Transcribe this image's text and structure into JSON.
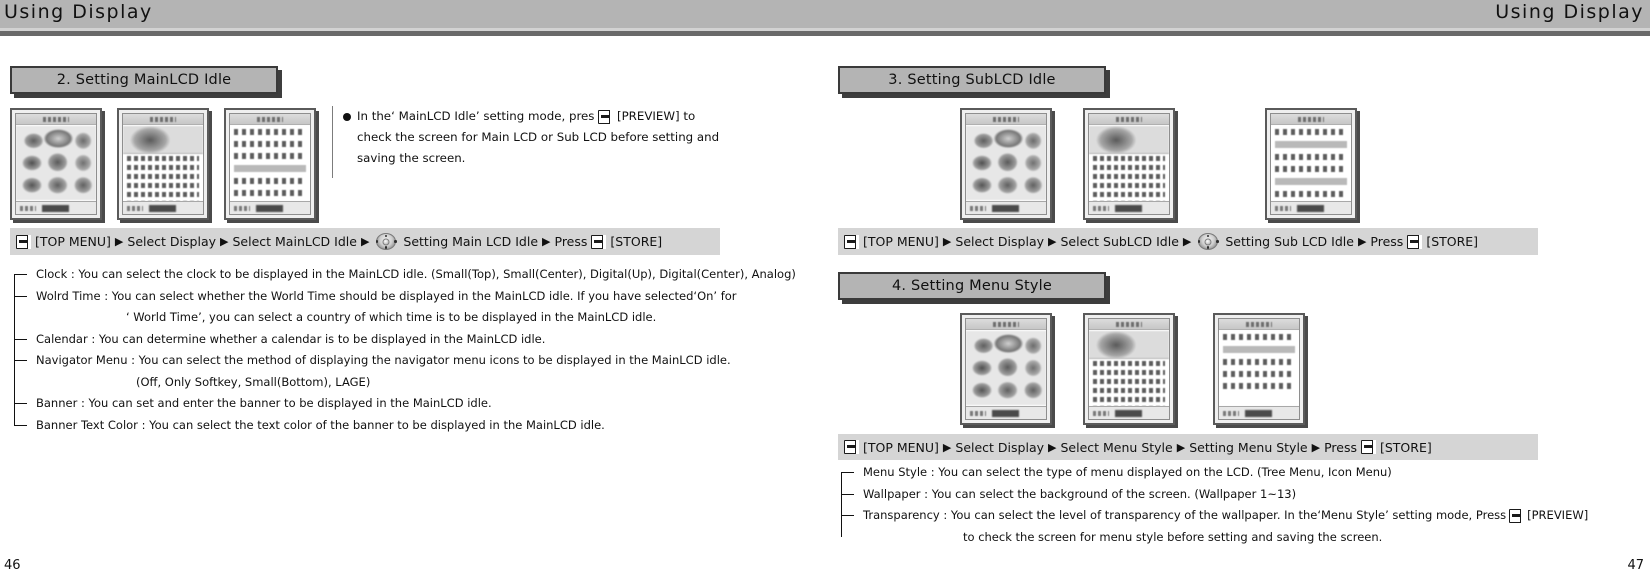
{
  "header": {
    "left_title": "Using Display",
    "right_title": "Using Display"
  },
  "page_numbers": {
    "left": "46",
    "right": "47"
  },
  "sections": {
    "main_lcd": {
      "heading": "2. Setting MainLCD Idle",
      "nav": {
        "key1": "key-button-icon",
        "top_menu": "[TOP MENU]",
        "a1": "▶",
        "step1": "Select Display",
        "a2": "▶",
        "step2": "Select MainLCD Idle",
        "a3": "▶",
        "pad": "navigation-pad-icon",
        "step3": "Setting Main LCD Idle",
        "a4": "▶",
        "press": "Press",
        "key2": "key-button-icon",
        "store": "[STORE]"
      },
      "note": {
        "line1": "In the‘ MainLCD Idle’ setting mode, pres",
        "line1b": "[PREVIEW] to",
        "line2": "check the screen for Main LCD or Sub LCD before setting and",
        "line3": "saving the screen."
      },
      "bullets": [
        {
          "text": "Clock : You can select the clock to be displayed in the MainLCD idle. (Small(Top), Small(Center), Digital(Up), Digital(Center), Analog)",
          "cont": false
        },
        {
          "text": "Wolrd Time : You can select whether the World Time should be displayed in the MainLCD idle. If you have selected‘On’ for",
          "cont": false
        },
        {
          "text": "‘ World Time’, you can select a country of which time is to be displayed in the MainLCD idle.",
          "cont": true,
          "indent": 90
        },
        {
          "text": "Calendar : You can determine whether a calendar is to be displayed in the MainLCD idle.",
          "cont": false
        },
        {
          "text": "Navigator Menu : You can select the method of displaying the navigator menu icons to be displayed in the MainLCD idle.",
          "cont": false
        },
        {
          "text": "(Off, Only Softkey, Small(Bottom), LAGE)",
          "cont": true,
          "indent": 100
        },
        {
          "text": "Banner : You can set and enter the banner to be displayed in the MainLCD idle.",
          "cont": false
        },
        {
          "text": "Banner Text Color : You can select the text color of the banner to be displayed in the MainLCD idle.",
          "cont": false
        }
      ]
    },
    "sub_lcd": {
      "heading": "3. Setting SubLCD Idle",
      "nav": {
        "top_menu": "[TOP MENU]",
        "a1": "▶",
        "step1": "Select Display",
        "a2": "▶",
        "step2": "Select SubLCD Idle",
        "a3": "▶",
        "step3": "Setting Sub LCD Idle",
        "a4": "▶",
        "press": "Press",
        "store": "[STORE]"
      }
    },
    "menu_style": {
      "heading": "4. Setting Menu Style",
      "nav": {
        "top_menu": "[TOP MENU]",
        "a1": "▶",
        "step1": "Select Display",
        "a2": "▶",
        "step2": "Select Menu Style",
        "a3": "▶",
        "step3": "Setting Menu Style",
        "a4": "▶",
        "press": "Press",
        "store": "[STORE]"
      },
      "bullets": [
        {
          "text": "Menu Style : You can select the type of menu displayed on the LCD. (Tree Menu, Icon Menu)",
          "cont": false
        },
        {
          "text": "Wallpaper : You can select the background of the screen. (Wallpaper 1~13)",
          "cont": false
        },
        {
          "text": "Transparency : You can select the level of transparency of the wallpaper. In the‘Menu Style’ setting mode, Press",
          "cont": false,
          "trailing_key": true,
          "trailing": "[PREVIEW]"
        },
        {
          "text": "to check the screen for menu style before setting and saving the screen.",
          "cont": true,
          "indent": 100
        }
      ]
    }
  },
  "colors": {
    "header_band": "#b4b4b4",
    "rule_dark": "#6a6a6a",
    "plate_fill": "#b4b4b4",
    "plate_border": "#3a3a3a",
    "navbar_fill": "#d5d5d5"
  }
}
